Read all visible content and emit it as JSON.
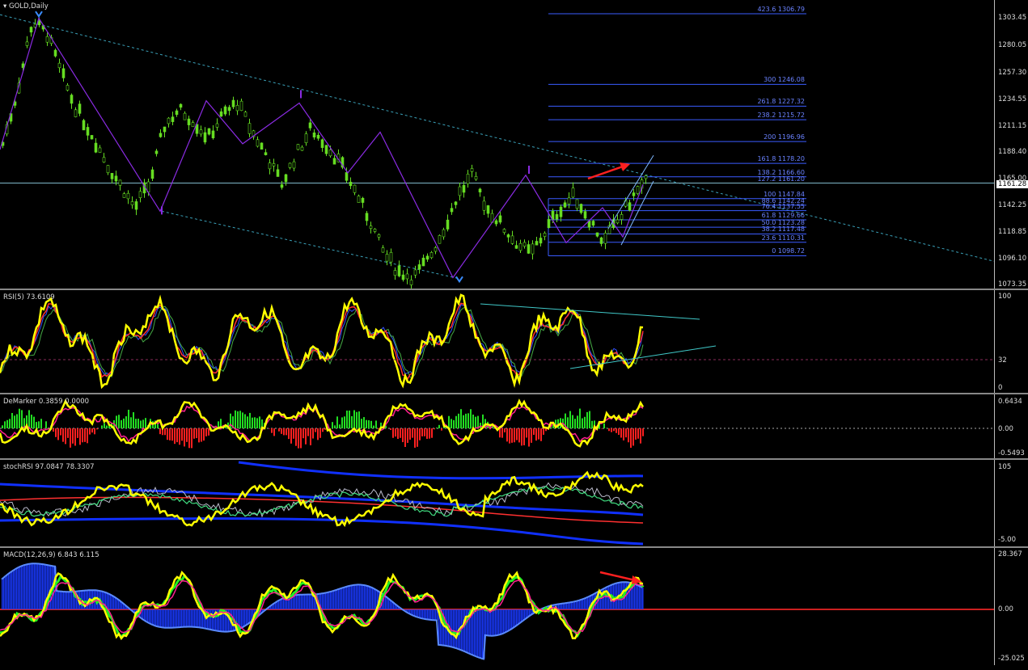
{
  "chart_title": "GOLD,Daily",
  "colors": {
    "background": "#000000",
    "candle_up": "#66dd22",
    "zigzag": "#8a2be2",
    "trend": "#3aa0b8",
    "fib": "#3a5bff",
    "arrow": "#ff2020",
    "yellow": "#ffff00",
    "blue": "#1030ff",
    "red": "#ff3030",
    "magenta": "#ff2090",
    "green": "#22dd22",
    "cyan": "#30c0e0"
  },
  "price_pane": {
    "current_price": "1161.28",
    "price_axis": [
      "1303.45",
      "1280.05",
      "1257.30",
      "1234.55",
      "1211.15",
      "1188.40",
      "1165.00",
      "1142.25",
      "1118.85",
      "1096.10",
      "1073.35"
    ],
    "fib_levels": [
      "423.6 1306.79",
      "300 1246.08",
      "261.8 1227.32",
      "238.2 1215.72",
      "200 1196.96",
      "161.8 1178.20",
      "138.2 1166.60",
      "127.2 1161.20",
      "100 1147.84",
      "88.6 1142.24",
      "76.4 1137.55",
      "61.8 1129.66",
      "50.0 1123.28",
      "38.2 1117.48",
      "23.6 1110.31",
      "0 1098.72"
    ]
  },
  "rsi_pane": {
    "title": "RSI(5) 73.6109",
    "axis": [
      "100",
      "32",
      "0"
    ]
  },
  "demarker_pane": {
    "title": "DeMarker 0.3859 0.0000",
    "axis": [
      "0.6434",
      "0.00",
      "-0.5493"
    ]
  },
  "stochrsi_pane": {
    "title": "stochRSI 97.0847 78.3307",
    "axis": [
      "105",
      "-5.00"
    ]
  },
  "macd_pane": {
    "title": "MACD(12,26,9) 6.843 6.115",
    "axis": [
      "28.367",
      "0.00",
      "-25.025"
    ]
  },
  "chart_data": {
    "type": "candlestick",
    "title": "GOLD,Daily",
    "symbol": "GOLD",
    "timeframe": "Daily",
    "ylim": [
      1073.35,
      1306.79
    ],
    "current_price": 1161.28,
    "price_path": [
      1195,
      1240,
      1300,
      1290,
      1255,
      1225,
      1205,
      1180,
      1160,
      1140,
      1160,
      1210,
      1225,
      1215,
      1200,
      1220,
      1230,
      1205,
      1185,
      1160,
      1185,
      1208,
      1195,
      1178,
      1155,
      1130,
      1100,
      1085,
      1080,
      1095,
      1120,
      1150,
      1168,
      1140,
      1125,
      1110,
      1100,
      1120,
      1140,
      1150,
      1130,
      1110,
      1130,
      1150,
      1165
    ],
    "zigzag": [
      [
        0,
        1190
      ],
      [
        48,
        1303
      ],
      [
        198,
        1137
      ],
      [
        255,
        1232
      ],
      [
        300,
        1195
      ],
      [
        370,
        1230
      ],
      [
        430,
        1170
      ],
      [
        470,
        1205
      ],
      [
        560,
        1080
      ],
      [
        650,
        1168
      ],
      [
        700,
        1110
      ],
      [
        745,
        1140
      ],
      [
        770,
        1115
      ],
      [
        795,
        1160
      ]
    ],
    "fibonacci": {
      "levels": [
        0,
        23.6,
        38.2,
        50.0,
        61.8,
        76.4,
        88.6,
        100,
        127.2,
        138.2,
        161.8,
        200,
        238.2,
        261.8,
        300,
        423.6
      ],
      "prices": [
        1098.72,
        1110.31,
        1117.48,
        1123.28,
        1129.66,
        1137.55,
        1142.24,
        1147.84,
        1161.2,
        1166.6,
        1178.2,
        1196.96,
        1215.72,
        1227.32,
        1246.08,
        1306.79
      ]
    },
    "indicators": [
      {
        "name": "RSI(5)",
        "value": 73.6109,
        "ylim": [
          0,
          100
        ],
        "level": 32
      },
      {
        "name": "DeMarker",
        "values": [
          0.3859,
          0.0
        ],
        "ylim": [
          -0.5493,
          0.6434
        ]
      },
      {
        "name": "stochRSI",
        "values": [
          97.0847,
          78.3307
        ],
        "ylim": [
          -5,
          105
        ]
      },
      {
        "name": "MACD(12,26,9)",
        "values": [
          6.843,
          6.115
        ],
        "ylim": [
          -25.025,
          28.367
        ]
      }
    ]
  }
}
